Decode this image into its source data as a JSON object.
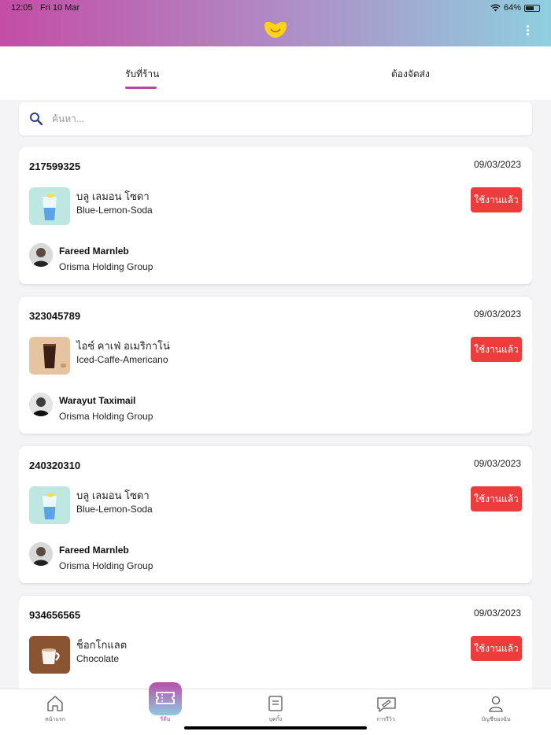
{
  "status_bar": {
    "time": "12:05",
    "date": "Fri 10 Mar",
    "battery": "64%",
    "battery_level": 0.64
  },
  "tabs": {
    "pickup": "รับที่ร้าน",
    "delivery": "ต้องจัดส่ง"
  },
  "search": {
    "placeholder": "ค้นหา..."
  },
  "orders": [
    {
      "order_no": "217599325",
      "date": "09/03/2023",
      "name_th": "บลู เลมอน โซดา",
      "name_en": "Blue-Lemon-Soda",
      "status_label": "ใช้งานแล้ว",
      "customer": "Fareed Marnleb",
      "company": "Orisma Holding Group"
    },
    {
      "order_no": "323045789",
      "date": "09/03/2023",
      "name_th": "ไอซ์ คาเฟ่ อเมริกาโน่",
      "name_en": "Iced-Caffe-Americano",
      "status_label": "ใช้งานแล้ว",
      "customer": "Warayut Taximail",
      "company": "Orisma Holding Group"
    },
    {
      "order_no": "240320310",
      "date": "09/03/2023",
      "name_th": "บลู เลมอน โซดา",
      "name_en": "Blue-Lemon-Soda",
      "status_label": "ใช้งานแล้ว",
      "customer": "Fareed Marnleb",
      "company": "Orisma Holding Group"
    },
    {
      "order_no": "934656565",
      "date": "09/03/2023",
      "name_th": "ช็อกโกแลต",
      "name_en": "Chocolate",
      "status_label": "ใช้งานแล้ว",
      "customer": "",
      "company": ""
    }
  ],
  "bottom_nav": [
    {
      "label": "หน้าแรก",
      "icon": "home-icon"
    },
    {
      "label": "รีดีม",
      "icon": "ticket-icon"
    },
    {
      "label": "บุคกิ้ง",
      "icon": "booking-icon"
    },
    {
      "label": "การรีวิว",
      "icon": "review-icon"
    },
    {
      "label": "บัญชีของฉัน",
      "icon": "account-icon"
    }
  ],
  "colors": {
    "accent": "#b04aa0",
    "used_button": "#ee3c3c"
  }
}
